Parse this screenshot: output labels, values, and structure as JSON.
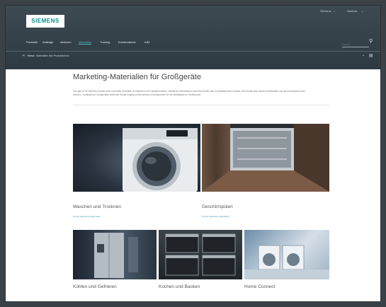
{
  "brand": {
    "logo": "SIEMENS"
  },
  "header": {
    "lang_1": "Siemens",
    "lang_2": "Gastros",
    "nav": [
      "Produkte",
      "Aufträge",
      "Aktionen",
      "Marketing",
      "Training",
      "Kundendienst",
      "AIM"
    ],
    "nav_active_index": 3,
    "search_placeholder": "Suche",
    "breadcrumb_home": "Home",
    "breadcrumb_current": "Materialien des Produktschutz"
  },
  "main": {
    "title": "Marketing-Materialien für Großgeräte",
    "intro": "Hier gibt es für Siemens Kunden einen schnellen Überblick zu Aktionen und Produktneuheiten. Sämtliche Informationen sind hier bereits nach Produktbereichen sortiert. Der Kunde kann seinen Fachhändler und die Informationen hier aufrufen. Zusätzlich zu Großgeräten bietet der Kunde Zugang zu Broschüren und Angeboten für die Weitergabe an Verbraucher."
  },
  "categories": [
    {
      "title": "Waschen und Trocknen",
      "link": "Zu den Marketing-Materialien"
    },
    {
      "title": "Geschirrspülen",
      "link": "Zu den Marketing-Materialien"
    },
    {
      "title": "Kühlen und Gefrieren",
      "link": ""
    },
    {
      "title": "Kochen und Backen",
      "link": ""
    },
    {
      "title": "Home Connect",
      "link": ""
    }
  ],
  "colors": {
    "accent": "#3a9bb0",
    "header_bg": "#2e3a42"
  }
}
